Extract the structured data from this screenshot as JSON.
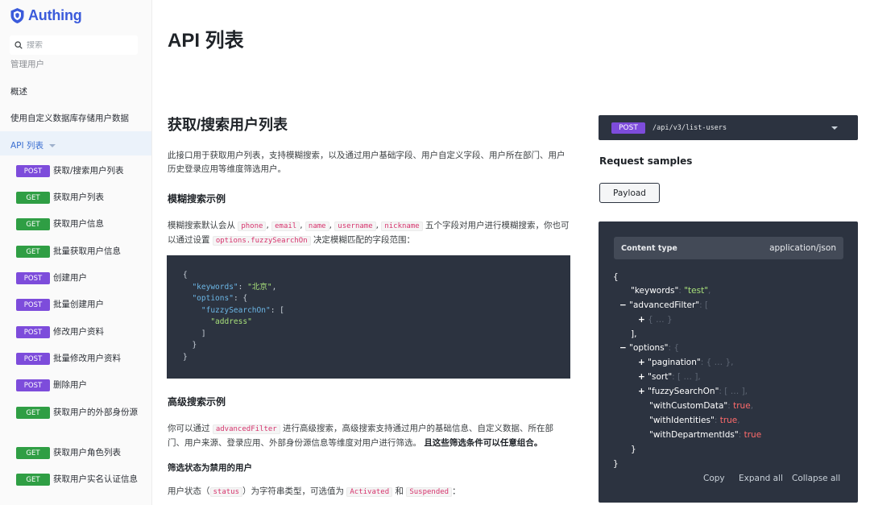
{
  "sidebar": {
    "logo_text": "Authing",
    "search_placeholder": "搜索",
    "cut_item": "管理用户",
    "items": [
      "概述",
      "使用自定义数据库存储用户数据"
    ],
    "active_item": "API 列表",
    "endpoints": [
      {
        "method": "POST",
        "label": "获取/搜索用户列表"
      },
      {
        "method": "GET",
        "label": "获取用户列表"
      },
      {
        "method": "GET",
        "label": "获取用户信息"
      },
      {
        "method": "GET",
        "label": "批量获取用户信息"
      },
      {
        "method": "POST",
        "label": "创建用户"
      },
      {
        "method": "POST",
        "label": "批量创建用户"
      },
      {
        "method": "POST",
        "label": "修改用户资料"
      },
      {
        "method": "POST",
        "label": "批量修改用户资料"
      },
      {
        "method": "POST",
        "label": "删除用户"
      },
      {
        "method": "GET",
        "label": "获取用户的外部身份源"
      },
      {
        "method": "GET",
        "label": "获取用户角色列表"
      },
      {
        "method": "GET",
        "label": "获取用户实名认证信息"
      }
    ]
  },
  "main": {
    "page_title": "API 列表",
    "section_title": "获取/搜索用户列表",
    "intro": "此接口用于获取用户列表，支持模糊搜索，以及通过用户基础字段、用户自定义字段、用户所在部门、用户历史登录应用等维度筛选用户。",
    "fuzzy_title": "模糊搜索示例",
    "fuzzy_para": {
      "t1": "模糊搜索默认会从",
      "c1": "phone",
      "c2": "email",
      "c3": "name",
      "c4": "username",
      "c5": "nickname",
      "t2": "五个字段对用户进行模糊搜索，你也可以通过设置",
      "c6": "options.fuzzySearchOn",
      "t3": "决定模糊匹配的字段范围："
    },
    "code": {
      "keywords_key": "\"keywords\"",
      "keywords_val": "\"北京\"",
      "options_key": "\"options\"",
      "fuzzy_key": "\"fuzzySearchOn\"",
      "address_val": "\"address\""
    },
    "advanced_title": "高级搜索示例",
    "advanced_para": {
      "t1": "你可以通过",
      "c1": "advancedFilter",
      "t2": "进行高级搜索，高级搜索支持通过用户的基础信息、自定义数据、所在部门、用户来源、登录应用、外部身份源信息等维度对用户进行筛选。",
      "t3": "且这些筛选条件可以任意组合。"
    },
    "filter_title": "筛选状态为禁用的用户",
    "status_para": {
      "t1": "用户状态（",
      "c1": "status",
      "t2": "）为字符串类型，可选值为",
      "c2": "Activated",
      "t3": "和",
      "c3": "Suspended",
      "t4": "："
    }
  },
  "right": {
    "method": "POST",
    "path": "/api/v3/list-users",
    "request_samples_title": "Request samples",
    "payload_tab": "Payload",
    "content_type_label": "Content type",
    "content_type_value": "application/json",
    "json": {
      "keywords_key": "\"keywords\"",
      "keywords_val": "\"test\"",
      "advanced_key": "\"advancedFilter\"",
      "options_key": "\"options\"",
      "pagination_key": "\"pagination\"",
      "sort_key": "\"sort\"",
      "fuzzy_key": "\"fuzzySearchOn\"",
      "custom_key": "\"withCustomData\"",
      "identities_key": "\"withIdentities\"",
      "dept_key": "\"withDepartmentIds\"",
      "true_val": "true",
      "collapsed_obj": "{ … }",
      "collapsed_arr": "[ … ]",
      "minus": "−",
      "plus": "+",
      "open_brace": "{",
      "close_brace": "}",
      "open_bracket": "[",
      "close_bracket": "],",
      "close_inner": "}"
    },
    "copy": "Copy",
    "expand_all": "Expand all",
    "collapse_all": "Collapse all"
  }
}
